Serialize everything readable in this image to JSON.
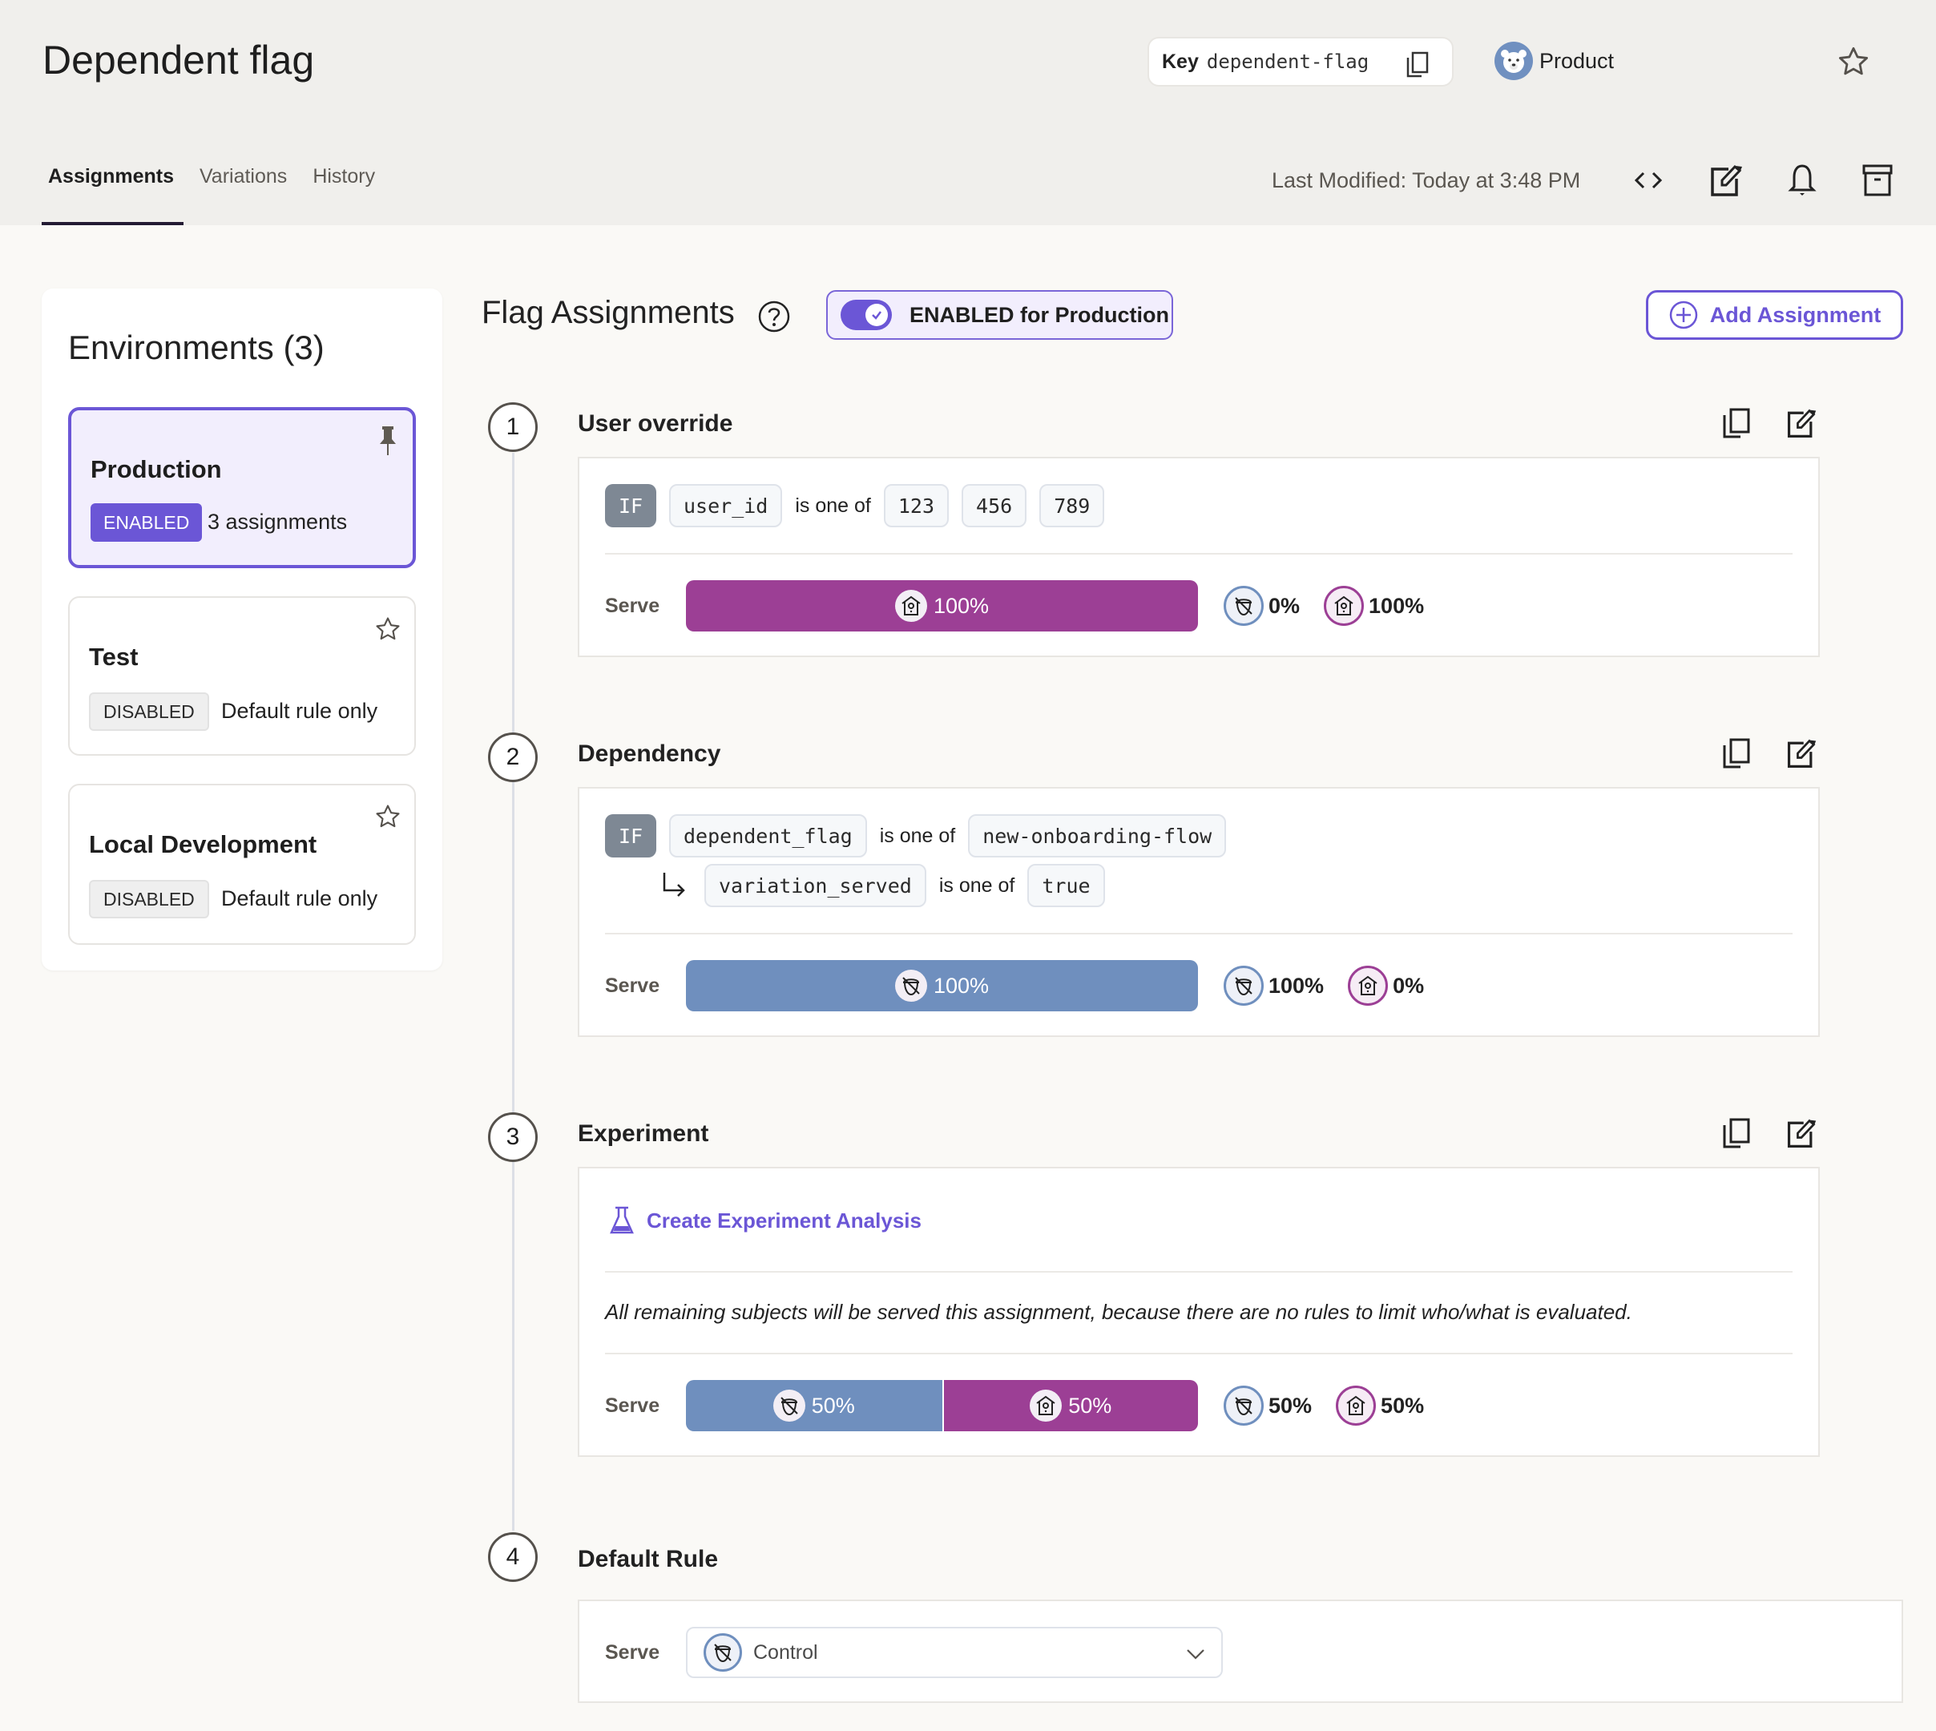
{
  "header": {
    "title": "Dependent flag",
    "key_label": "Key",
    "key_value": "dependent-flag",
    "team": "Product",
    "tabs": [
      "Assignments",
      "Variations",
      "History"
    ],
    "active_tab": "Assignments",
    "last_modified": "Last Modified: Today at 3:48 PM"
  },
  "environments": {
    "title": "Environments (3)",
    "items": [
      {
        "name": "Production",
        "status": "ENABLED",
        "detail": "3 assignments",
        "selected": true,
        "icon": "pin-icon"
      },
      {
        "name": "Test",
        "status": "DISABLED",
        "detail": "Default rule only",
        "selected": false,
        "icon": "star-icon"
      },
      {
        "name": "Local Development",
        "status": "DISABLED",
        "detail": "Default rule only",
        "selected": false,
        "icon": "star-icon"
      }
    ]
  },
  "main": {
    "title": "Flag Assignments",
    "toggle_label": "ENABLED for Production",
    "toggle_on": true,
    "add_button": "Add Assignment",
    "serve_label": "Serve",
    "if_label": "IF",
    "colors": {
      "control": "#6f8fbe",
      "treatment": "#9c3f95",
      "accent": "#6b56d6"
    },
    "rules": [
      {
        "number": "1",
        "title": "User override",
        "conditions": [
          {
            "attribute": "user_id",
            "operator": "is one of",
            "values": [
              "123",
              "456",
              "789"
            ]
          }
        ],
        "serve": [
          {
            "variation": "treatment",
            "percent": "100%"
          }
        ],
        "legend": [
          {
            "variation": "control",
            "percent": "0%"
          },
          {
            "variation": "treatment",
            "percent": "100%"
          }
        ]
      },
      {
        "number": "2",
        "title": "Dependency",
        "conditions": [
          {
            "attribute": "dependent_flag",
            "operator": "is one of",
            "values": [
              "new-onboarding-flow"
            ]
          },
          {
            "attribute": "variation_served",
            "operator": "is one of",
            "values": [
              "true"
            ]
          }
        ],
        "serve": [
          {
            "variation": "control",
            "percent": "100%"
          }
        ],
        "legend": [
          {
            "variation": "control",
            "percent": "100%"
          },
          {
            "variation": "treatment",
            "percent": "0%"
          }
        ]
      },
      {
        "number": "3",
        "title": "Experiment",
        "experiment_link": "Create Experiment Analysis",
        "note": "All remaining subjects will be served this assignment, because there are no rules to limit who/what is evaluated.",
        "serve": [
          {
            "variation": "control",
            "percent": "50%"
          },
          {
            "variation": "treatment",
            "percent": "50%"
          }
        ],
        "legend": [
          {
            "variation": "control",
            "percent": "50%"
          },
          {
            "variation": "treatment",
            "percent": "50%"
          }
        ]
      },
      {
        "number": "4",
        "title": "Default Rule",
        "serve_select": "Control"
      }
    ]
  }
}
